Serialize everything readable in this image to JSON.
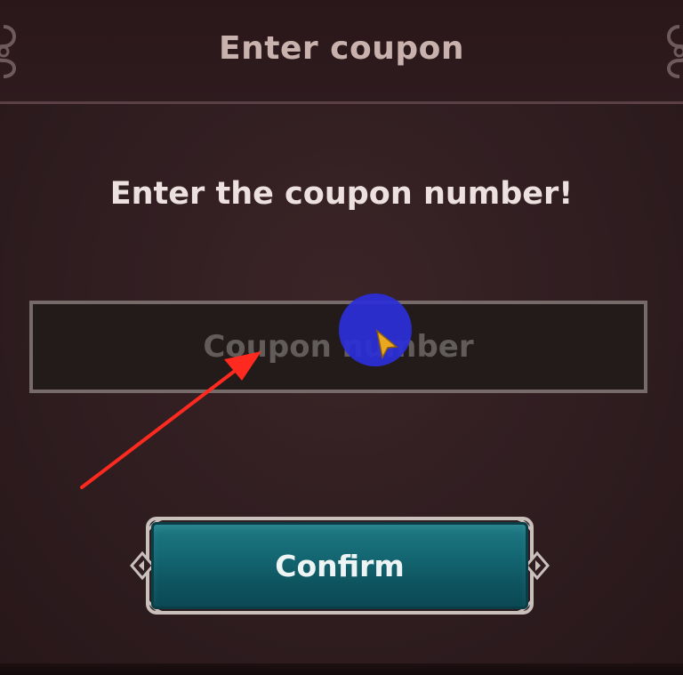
{
  "dialog": {
    "title": "Enter coupon",
    "prompt": "Enter the coupon number!",
    "input": {
      "placeholder": "Coupon number",
      "value": ""
    },
    "confirm_label": "Confirm"
  },
  "colors": {
    "panel_background": "#2f1d20",
    "title_text": "#c9b2ad",
    "prompt_text": "#ece1de",
    "input_background": "#231b1a",
    "input_border": "#766b68",
    "placeholder_text": "#615c59",
    "button_teal": "#146873",
    "button_frame": "#c9c0bb",
    "touch_indicator": "#2b2fd9",
    "annotation_arrow": "#ff2a1f",
    "cursor": "#e9a81f"
  },
  "icons": {
    "corner_ornaments": "scroll-ornament-icon",
    "button_side_ornaments": "diamond-arrow-icon",
    "pointer": "cursor-arrow-icon",
    "annotation": "red-arrow-icon"
  }
}
